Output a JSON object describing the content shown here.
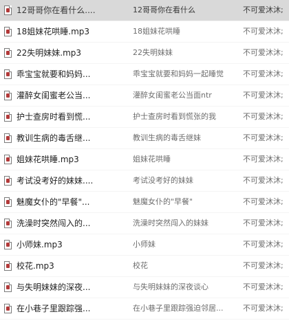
{
  "files": [
    {
      "name": "12哥哥你在看什么....",
      "title": "12哥哥你在看什么",
      "artist": "不可爱沐沐;",
      "selected": true
    },
    {
      "name": "18姐妹花哄睡.mp3",
      "title": "18姐妹花哄睡",
      "artist": "不可爱沐沐;",
      "selected": false
    },
    {
      "name": "22失明妹妹.mp3",
      "title": "22失明妹妹",
      "artist": "不可爱沐沐;",
      "selected": false
    },
    {
      "name": "乖宝宝就要和妈妈...",
      "title": "乖宝宝就要和妈妈一起睡觉",
      "artist": "不可爱沐沐;",
      "selected": false
    },
    {
      "name": "灌醉女闺蜜老公当...",
      "title": "灌醉女闺蜜老公当面ntr",
      "artist": "不可爱沐沐;",
      "selected": false
    },
    {
      "name": "护士查房时看到慌...",
      "title": "护士查房时看到慌张的我",
      "artist": "不可爱沐沐;",
      "selected": false
    },
    {
      "name": "教训生病的毒舌继...",
      "title": "教训生病的毒舌继妹",
      "artist": "不可爱沐沐;",
      "selected": false
    },
    {
      "name": "姐妹花哄睡.mp3",
      "title": "姐妹花哄睡",
      "artist": "不可爱沐沐;",
      "selected": false
    },
    {
      "name": "考试没考好的妹妹....",
      "title": "考试没考好的妹妹",
      "artist": "不可爱沐沐;",
      "selected": false
    },
    {
      "name": "魅魔女仆的\"早餐\"...",
      "title": "魅魔女仆的\"早餐\"",
      "artist": "不可爱沐沐;",
      "selected": false
    },
    {
      "name": "洗澡时突然闯入的...",
      "title": "洗澡时突然闯入的妹妹",
      "artist": "不可爱沐沐;",
      "selected": false
    },
    {
      "name": "小师妹.mp3",
      "title": "小师妹",
      "artist": "不可爱沐沐;",
      "selected": false
    },
    {
      "name": "校花.mp3",
      "title": "校花",
      "artist": "不可爱沐沐;",
      "selected": false
    },
    {
      "name": "与失明妹妹的深夜...",
      "title": "与失明妹妹的深夜谈心",
      "artist": "不可爱沐沐;",
      "selected": false
    },
    {
      "name": "在小巷子里跟踪强...",
      "title": "在小巷子里跟踪强迫邻居...",
      "artist": "不可爱沐沐;",
      "selected": false
    }
  ],
  "icon": "audio-file-icon",
  "colors": {
    "selected_row": "#d9d9d9",
    "name_text": "#1f1f1f",
    "secondary_text": "#6d6d6d",
    "icon_accent": "#b33a3a"
  }
}
